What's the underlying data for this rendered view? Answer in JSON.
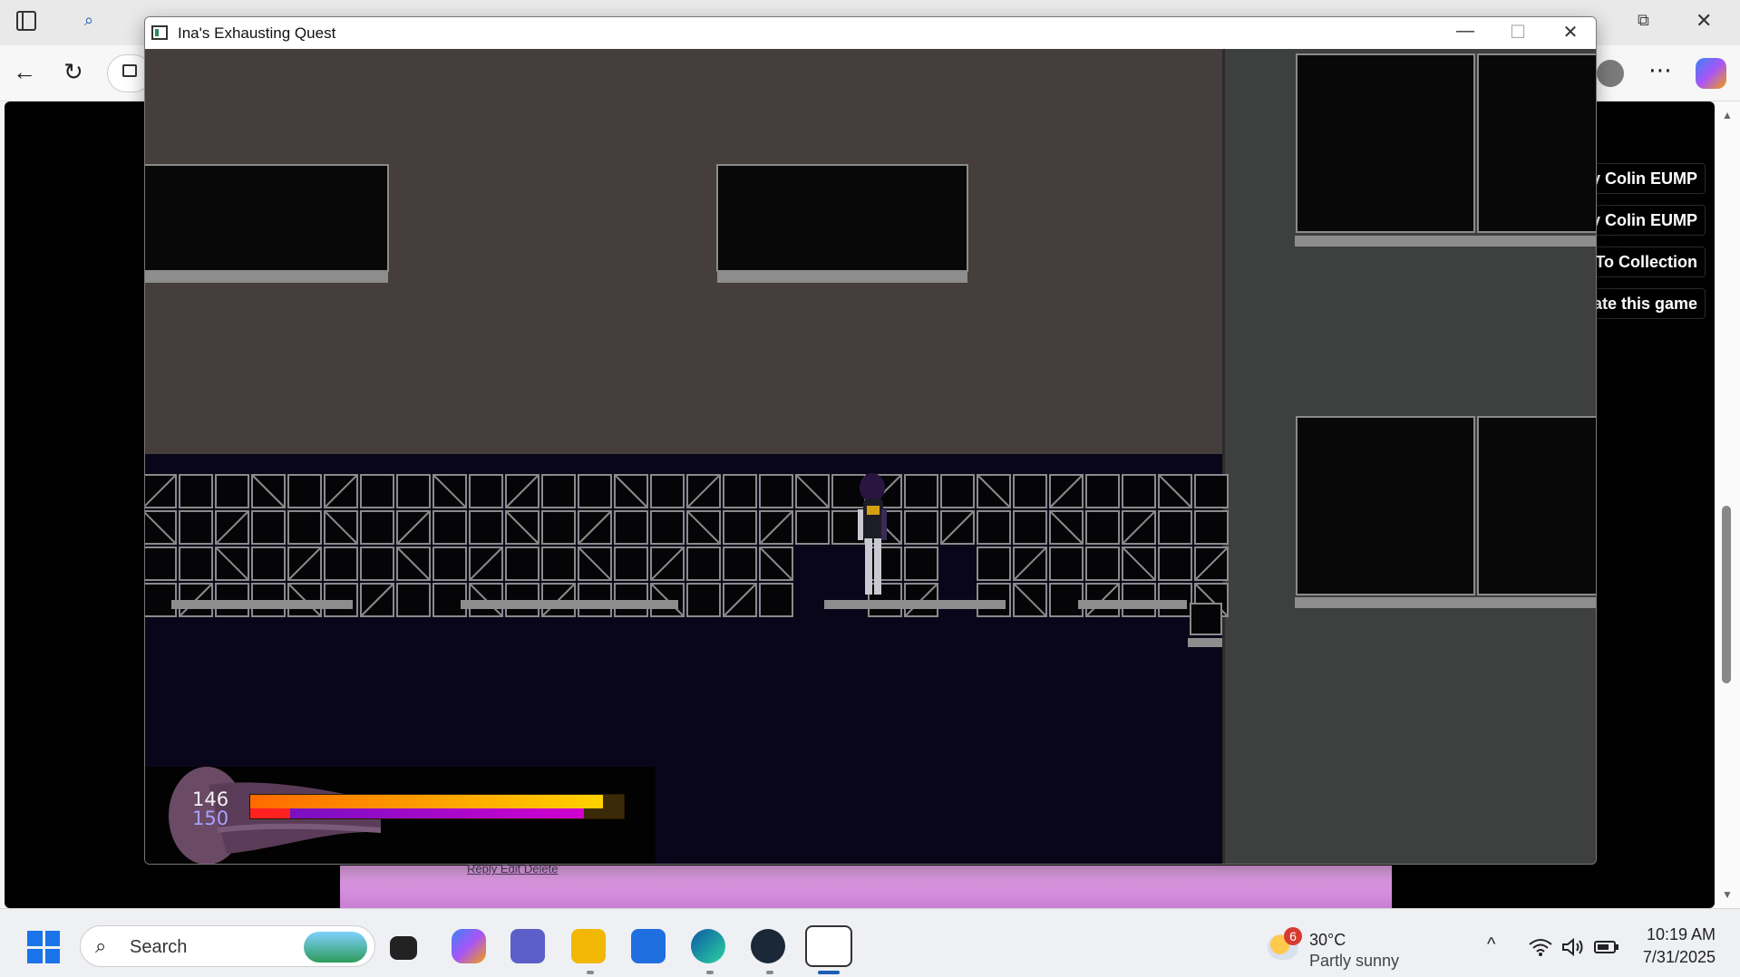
{
  "window": {
    "title": "Ina's Exhausting Quest",
    "minimize": "—",
    "maximize": "☐",
    "close": "✕"
  },
  "browser": {
    "restore_glyph": "⧉",
    "close_glyph": "✕",
    "back_glyph": "←",
    "refresh_glyph": "↻",
    "more_glyph": "⋯"
  },
  "page_buttons": [
    {
      "label": "y Colin EUMP"
    },
    {
      "label": "y Colin EUMP"
    },
    {
      "label": "To Collection"
    },
    {
      "label": "ate this game"
    }
  ],
  "page_links": "Reply  Edit  Delete",
  "hud": {
    "hp": "146",
    "mp": "150",
    "hp_fraction": 0.94,
    "mp_fraction": 0.89,
    "colors": {
      "hp_start": "#ff6a00",
      "hp_end": "#ffd200",
      "mp_start": "#7a10c0",
      "mp_end": "#d000d0"
    }
  },
  "taskbar": {
    "search_placeholder": "Search",
    "weather": {
      "badge": "6",
      "temp": "30°C",
      "condition": "Partly sunny"
    },
    "time": "10:19 AM",
    "date": "7/31/2025",
    "tray_chevron": "^",
    "wifi_glyph": "wifi",
    "volume_glyph": "volume",
    "battery_glyph": "battery"
  }
}
